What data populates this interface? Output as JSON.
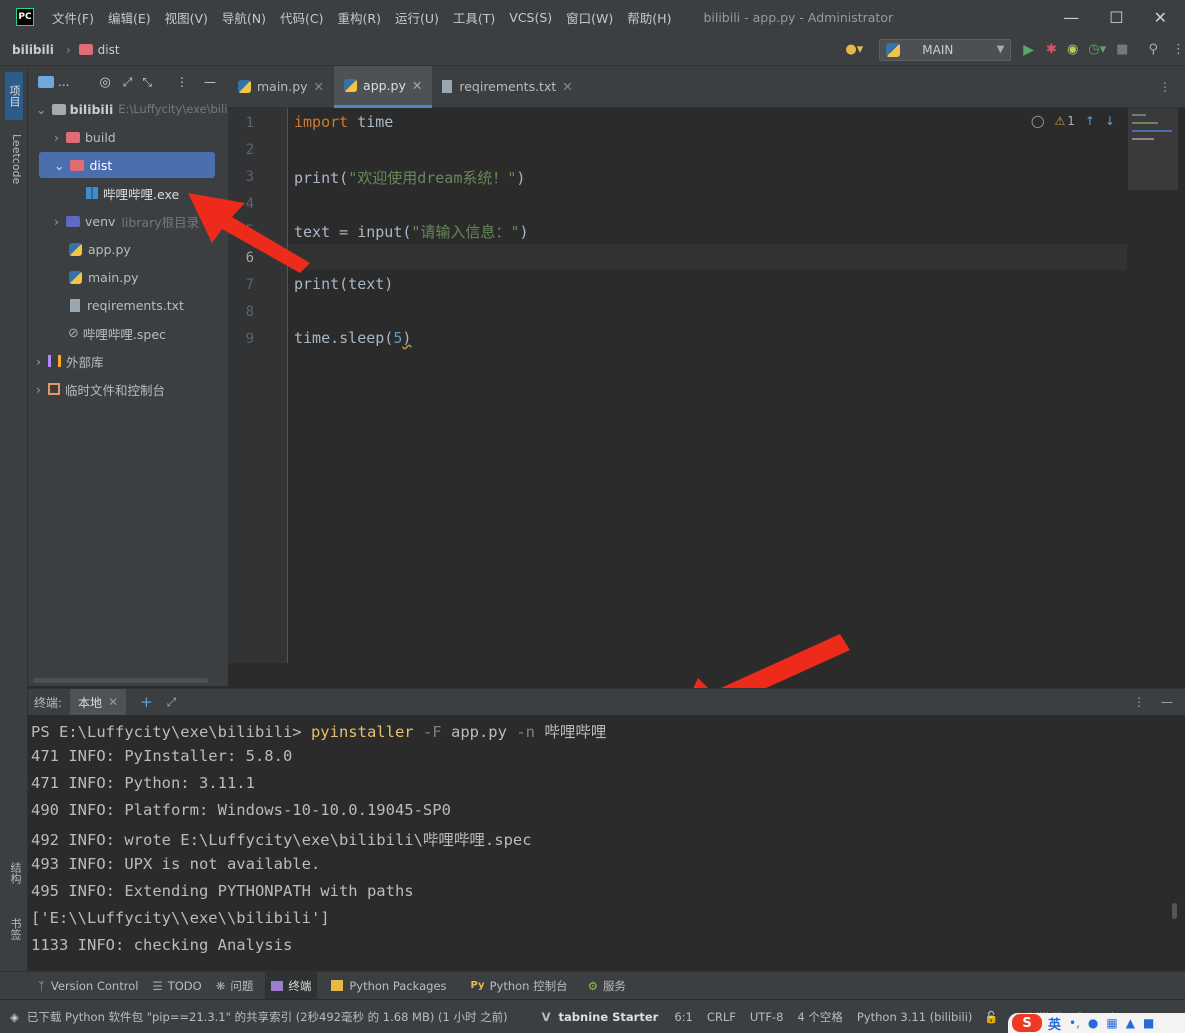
{
  "app": {
    "logo": "PC",
    "window_title": "bilibili - app.py - Administrator"
  },
  "menu": [
    "文件(F)",
    "编辑(E)",
    "视图(V)",
    "导航(N)",
    "代码(C)",
    "重构(R)",
    "运行(U)",
    "工具(T)",
    "VCS(S)",
    "窗口(W)",
    "帮助(H)"
  ],
  "breadcrumb": {
    "project": "bilibili",
    "folder": "dist"
  },
  "run_config": "MAIN",
  "left_strip": {
    "project": "项目",
    "leetcode": "Leetcode",
    "structure": "结构",
    "bookmarks": "书签"
  },
  "project_panel": {
    "title": "...",
    "root": {
      "name": "bilibili",
      "path": "E:\\Luffycity\\exe\\bilib"
    },
    "items": [
      {
        "label": "build",
        "type": "folder"
      },
      {
        "label": "dist",
        "type": "folder"
      },
      {
        "label": "哔哩哔哩.exe",
        "type": "exe"
      },
      {
        "label": "venv",
        "hint": "library根目录",
        "type": "venv"
      },
      {
        "label": "app.py",
        "type": "py"
      },
      {
        "label": "main.py",
        "type": "py"
      },
      {
        "label": "reqirements.txt",
        "type": "txt"
      },
      {
        "label": "哔哩哔哩.spec",
        "type": "spec"
      },
      {
        "label": "外部库",
        "type": "lib"
      },
      {
        "label": "临时文件和控制台",
        "type": "scratch"
      }
    ]
  },
  "tabs": [
    {
      "label": "main.py"
    },
    {
      "label": "app.py"
    },
    {
      "label": "reqirements.txt"
    }
  ],
  "editor": {
    "warnings": "1",
    "lines": [
      {
        "n": "1",
        "t": "import time"
      },
      {
        "n": "2",
        "t": ""
      },
      {
        "n": "3",
        "t": "print(\"欢迎使用dream系统！\")"
      },
      {
        "n": "4",
        "t": ""
      },
      {
        "n": "5",
        "t": "text = input(\"请输入信息：\")"
      },
      {
        "n": "6",
        "t": ""
      },
      {
        "n": "7",
        "t": "print(text)"
      },
      {
        "n": "8",
        "t": ""
      },
      {
        "n": "9",
        "t": "time.sleep(5)"
      }
    ]
  },
  "terminal": {
    "label": "终端:",
    "tab": "本地",
    "prompt": "PS E:\\Luffycity\\exe\\bilibili>",
    "command": "pyinstaller",
    "flag1": "-F",
    "arg1": "app.py",
    "flag2": "-n",
    "arg2": "哔哩哔哩",
    "output": [
      "471 INFO: PyInstaller: 5.8.0",
      "471 INFO: Python: 3.11.1",
      "490 INFO: Platform: Windows-10-10.0.19045-SP0",
      "492 INFO: wrote E:\\Luffycity\\exe\\bilibili\\哔哩哔哩.spec",
      "493 INFO: UPX is not available.",
      "495 INFO: Extending PYTHONPATH with paths",
      "['E:\\\\Luffycity\\\\exe\\\\bilibili']",
      "1133 INFO: checking Analysis"
    ]
  },
  "toolwindows": [
    "Version Control",
    "TODO",
    "问题",
    "终端",
    "Python Packages",
    "Python 控制台",
    "服务"
  ],
  "status": {
    "message": "已下载 Python 软件包 \"pip==21.3.1\" 的共享索引 (2秒492毫秒 的 1.68 MB) (1 小时 之前)",
    "tabnine": "tabnine Starter",
    "pos": "6:1",
    "eol": "CRLF",
    "enc": "UTF-8",
    "indent": "4 个空格",
    "interp": "Python 3.11 (bilibili)",
    "extra1": "bilibili",
    "extra2": "Dracula"
  },
  "ime": {
    "lang": "英"
  }
}
